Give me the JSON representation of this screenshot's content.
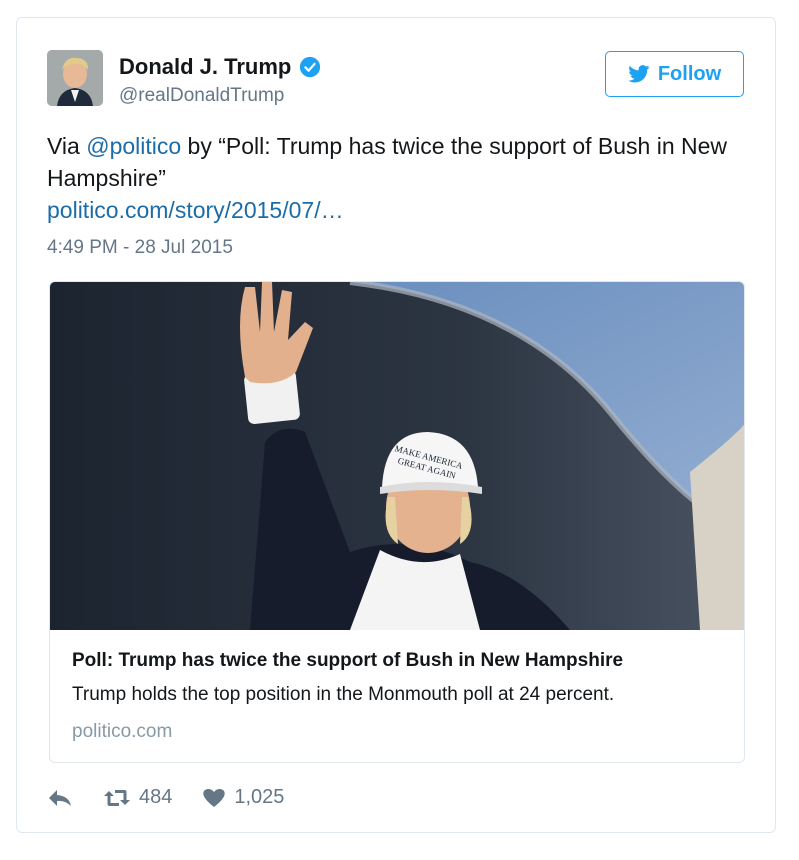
{
  "tweet": {
    "display_name": "Donald J. Trump",
    "handle": "@realDonaldTrump",
    "follow_label": "Follow",
    "text_prefix": "Via ",
    "mention": "@politico",
    "text_body": " by “Poll: Trump has twice the support of Bush in New Hampshire”",
    "url": "politico.com/story/2015/07/…",
    "timestamp": "4:49 PM - 28 Jul 2015"
  },
  "card": {
    "title": "Poll: Trump has twice the support of Bush in New Hampshire",
    "description": "Trump holds the top position in the Monmouth poll at 24 percent.",
    "domain": "politico.com",
    "hat_text_line1": "MAKE AMERICA",
    "hat_text_line2": "GREAT AGAIN"
  },
  "actions": {
    "retweets": "484",
    "likes": "1,025"
  },
  "colors": {
    "accent": "#1da1f2",
    "link": "#1b6ca8",
    "muted": "#657786"
  },
  "icons": [
    "verified-badge-icon",
    "twitter-bird-icon",
    "reply-icon",
    "retweet-icon",
    "heart-icon"
  ]
}
